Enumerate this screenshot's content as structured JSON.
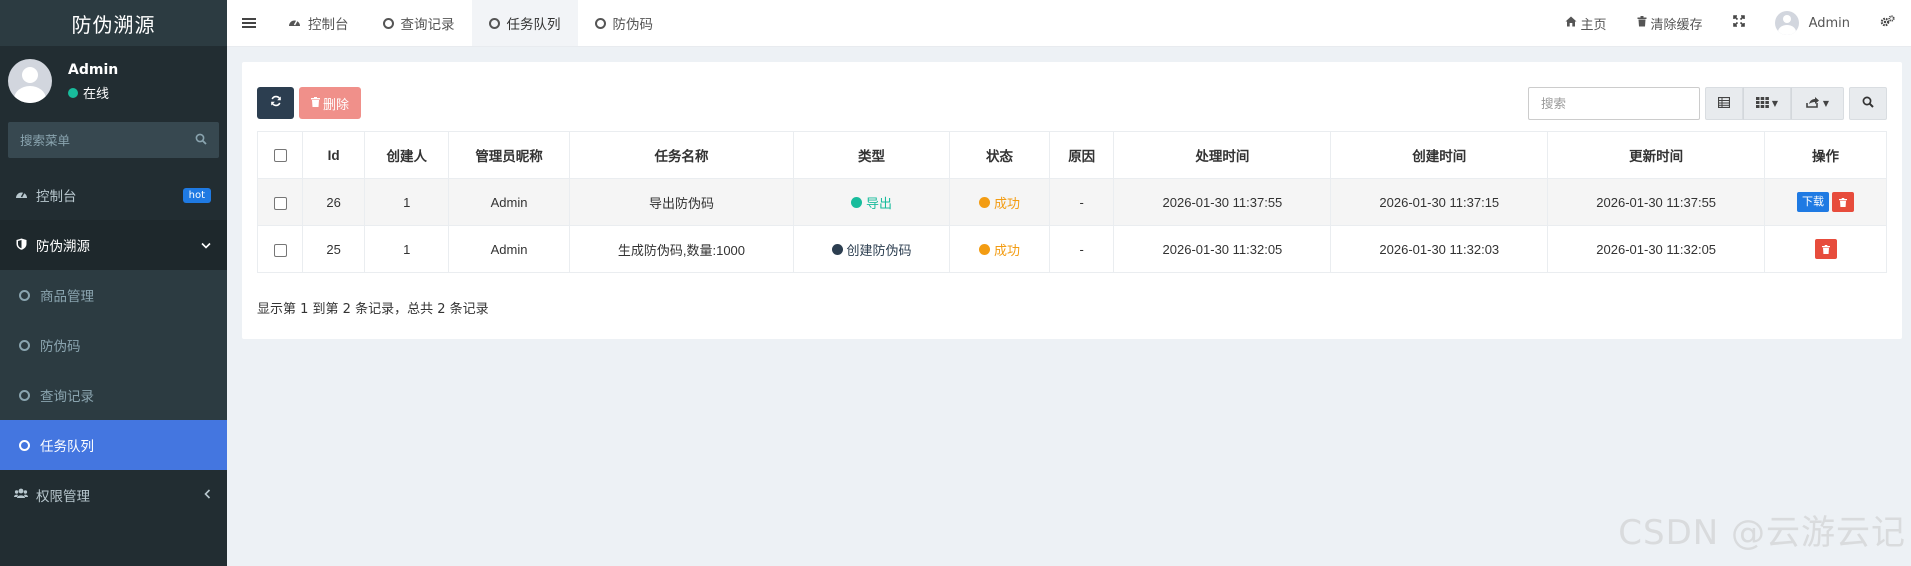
{
  "app": {
    "logo": "防伪溯源"
  },
  "user": {
    "name": "Admin",
    "status": "在线"
  },
  "sidebar": {
    "search_placeholder": "搜索菜单",
    "items": [
      {
        "label": "控制台",
        "icon": "dashboard-icon",
        "badge": "hot"
      },
      {
        "label": "防伪溯源",
        "icon": "shield-icon",
        "expanded": true,
        "children": [
          "商品管理",
          "防伪码",
          "查询记录",
          "任务队列"
        ],
        "active_child": "任务队列"
      },
      {
        "label": "权限管理",
        "icon": "users-icon"
      }
    ]
  },
  "topnav": {
    "tabs": [
      {
        "label": "控制台",
        "icon": "dashboard-icon"
      },
      {
        "label": "查询记录",
        "icon": "circle-icon"
      },
      {
        "label": "任务队列",
        "icon": "circle-icon",
        "active": true
      },
      {
        "label": "防伪码",
        "icon": "circle-icon"
      }
    ],
    "home": "主页",
    "clear_cache": "清除缓存",
    "user": "Admin"
  },
  "toolbar": {
    "delete_label": "删除",
    "search_placeholder": "搜索"
  },
  "table": {
    "columns": [
      "Id",
      "创建人",
      "管理员昵称",
      "任务名称",
      "类型",
      "状态",
      "原因",
      "处理时间",
      "创建时间",
      "更新时间",
      "操作"
    ],
    "rows": [
      {
        "id": "26",
        "creator": "1",
        "nickname": "Admin",
        "task_name": "导出防伪码",
        "type": "导出",
        "status": "成功",
        "reason": "-",
        "processed": "2026-01-30 11:37:55",
        "created": "2026-01-30 11:37:15",
        "updated": "2026-01-30 11:37:55",
        "download": "下载"
      },
      {
        "id": "25",
        "creator": "1",
        "nickname": "Admin",
        "task_name": "生成防伪码,数量:1000",
        "type": "创建防伪码",
        "status": "成功",
        "reason": "-",
        "processed": "2026-01-30 11:32:05",
        "created": "2026-01-30 11:32:03",
        "updated": "2026-01-30 11:32:05"
      }
    ],
    "footer": "显示第 1 到第 2 条记录，总共 2 条记录"
  },
  "watermark": "CSDN @云游云记",
  "colors": {
    "sidebar_bg": "#222d32",
    "active": "#4476e0",
    "primary": "#1f7ae3",
    "danger": "#e74c3c",
    "success": "#18bc9c",
    "warning": "#f39c12"
  }
}
